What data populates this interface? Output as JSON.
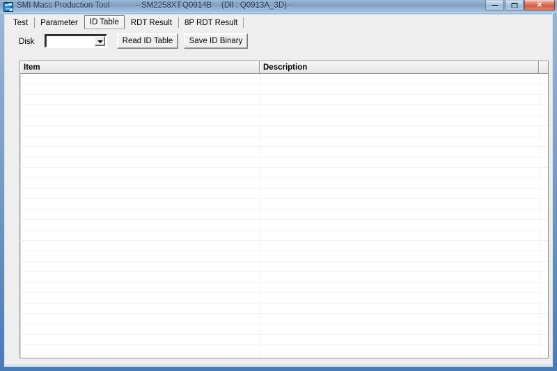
{
  "window": {
    "title": "SMI Mass Production Tool",
    "meta": {
      "dash_left": "-",
      "chip": "SM2258XT",
      "fw": "Q0914B",
      "dll": "(Dll : Q0913A_3D)",
      "dash_right": "-"
    },
    "icon": "app-icon",
    "controls": {
      "minimize": "minimize-icon",
      "maximize": "maximize-icon",
      "close": "✕"
    },
    "accent_color": "#4a7ab5",
    "close_color": "#cd5a45"
  },
  "tabs": [
    {
      "label": "Test",
      "selected": false
    },
    {
      "label": "Parameter",
      "selected": false
    },
    {
      "label": "ID Table",
      "selected": true
    },
    {
      "label": "RDT Result",
      "selected": false
    },
    {
      "label": "8P RDT Result",
      "selected": false
    }
  ],
  "toolbar": {
    "disk_label": "Disk",
    "disk_value": "",
    "disk_placeholder": "",
    "dropdown_icon": "chevron-down-icon",
    "read_id_table_label": "Read ID Table",
    "save_id_binary_label": "Save ID Binary"
  },
  "id_table": {
    "columns": [
      "Item",
      "Description",
      ""
    ],
    "rows": [],
    "row_count": 0,
    "empty": true
  }
}
